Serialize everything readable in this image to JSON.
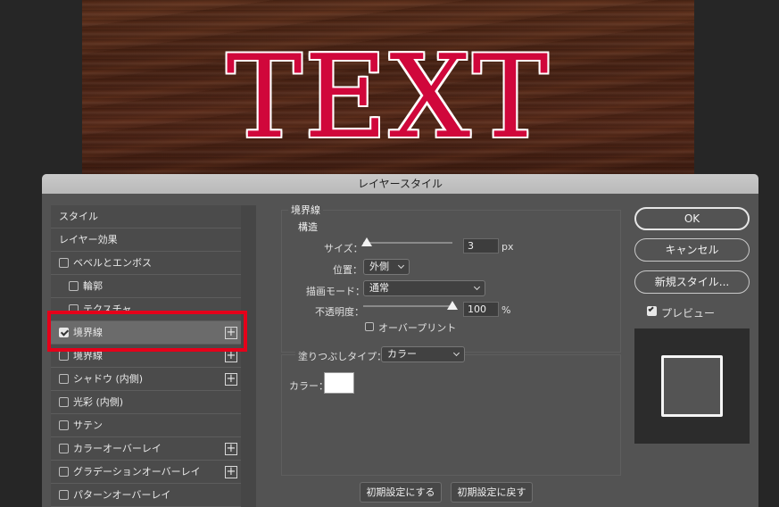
{
  "canvas": {
    "text": "TEXT"
  },
  "dialog": {
    "title": "レイヤースタイル",
    "style_list": [
      {
        "label": "スタイル",
        "checkbox": false,
        "plus": false
      },
      {
        "label": "レイヤー効果",
        "checkbox": false,
        "plus": false
      },
      {
        "label": "ベベルとエンボス",
        "checkbox": true,
        "checked": false,
        "plus": false
      },
      {
        "label": "輪郭",
        "checkbox": true,
        "checked": false,
        "plus": false,
        "indent": true
      },
      {
        "label": "テクスチャ",
        "checkbox": true,
        "checked": false,
        "plus": false,
        "indent": true
      },
      {
        "label": "境界線",
        "checkbox": true,
        "checked": true,
        "plus": true,
        "selected": true
      },
      {
        "label": "境界線",
        "checkbox": true,
        "checked": false,
        "plus": true
      },
      {
        "label": "シャドウ (内側)",
        "checkbox": true,
        "checked": false,
        "plus": true
      },
      {
        "label": "光彩 (内側)",
        "checkbox": true,
        "checked": false,
        "plus": false
      },
      {
        "label": "サテン",
        "checkbox": true,
        "checked": false,
        "plus": false
      },
      {
        "label": "カラーオーバーレイ",
        "checkbox": true,
        "checked": false,
        "plus": true
      },
      {
        "label": "グラデーションオーバーレイ",
        "checkbox": true,
        "checked": false,
        "plus": true
      },
      {
        "label": "パターンオーバーレイ",
        "checkbox": true,
        "checked": false,
        "plus": false
      }
    ],
    "stroke": {
      "section_title": "境界線",
      "structure_title": "構造",
      "size_label": "サイズ：",
      "size_value": "3",
      "size_unit": "px",
      "position_label": "位置：",
      "position_value": "外側",
      "blend_label": "描画モード：",
      "blend_value": "通常",
      "opacity_label": "不透明度：",
      "opacity_value": "100",
      "opacity_unit": "%",
      "overprint_label": "オーバープリント",
      "fill_type_label": "塗りつぶしタイプ：",
      "fill_type_value": "カラー",
      "color_label": "カラー：",
      "color_value": "#ffffff"
    },
    "buttons": {
      "make_default": "初期設定にする",
      "reset_default": "初期設定に戻す",
      "ok": "OK",
      "cancel": "キャンセル",
      "new_style": "新規スタイル...",
      "preview": "プレビュー"
    }
  }
}
